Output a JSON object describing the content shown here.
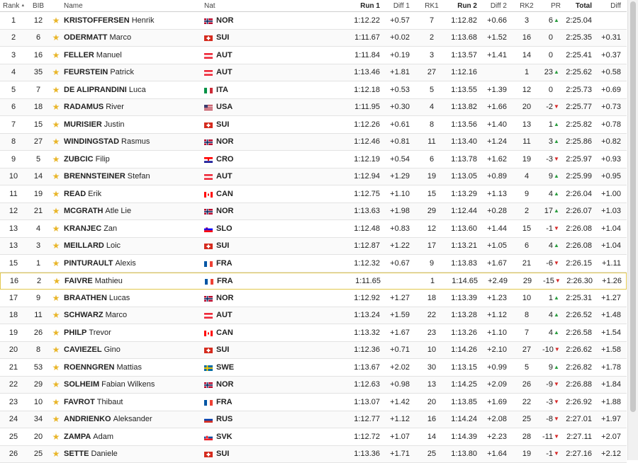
{
  "headers": {
    "rank": "Rank",
    "bib": "BIB",
    "name": "Name",
    "nat": "Nat",
    "run1": "Run 1",
    "diff1": "Diff 1",
    "rk1": "RK1",
    "run2": "Run 2",
    "diff2": "Diff 2",
    "rk2": "RK2",
    "pr": "PR",
    "total": "Total",
    "diff": "Diff"
  },
  "highlight_rank_row": 15,
  "rows": [
    {
      "rank": "1",
      "bib": "12",
      "last": "KRISTOFFERSEN",
      "first": "Henrik",
      "nat": "NOR",
      "flag": "nor",
      "run1": "1:12.22",
      "diff1": "+0.57",
      "rk1": "7",
      "run2": "1:12.82",
      "diff2": "+0.66",
      "rk2": "3",
      "pr": "6",
      "pr_dir": "up",
      "total": "2:25.04",
      "diff": ""
    },
    {
      "rank": "2",
      "bib": "6",
      "last": "ODERMATT",
      "first": "Marco",
      "nat": "SUI",
      "flag": "sui",
      "run1": "1:11.67",
      "diff1": "+0.02",
      "rk1": "2",
      "run2": "1:13.68",
      "diff2": "+1.52",
      "rk2": "16",
      "pr": "0",
      "pr_dir": "zero",
      "total": "2:25.35",
      "diff": "+0.31"
    },
    {
      "rank": "3",
      "bib": "16",
      "last": "FELLER",
      "first": "Manuel",
      "nat": "AUT",
      "flag": "aut",
      "run1": "1:11.84",
      "diff1": "+0.19",
      "rk1": "3",
      "run2": "1:13.57",
      "diff2": "+1.41",
      "rk2": "14",
      "pr": "0",
      "pr_dir": "zero",
      "total": "2:25.41",
      "diff": "+0.37"
    },
    {
      "rank": "4",
      "bib": "35",
      "last": "FEURSTEIN",
      "first": "Patrick",
      "nat": "AUT",
      "flag": "aut",
      "run1": "1:13.46",
      "diff1": "+1.81",
      "rk1": "27",
      "run2": "1:12.16",
      "diff2": "",
      "rk2": "1",
      "pr": "23",
      "pr_dir": "up",
      "total": "2:25.62",
      "diff": "+0.58"
    },
    {
      "rank": "5",
      "bib": "7",
      "last": "DE ALIPRANDINI",
      "first": "Luca",
      "nat": "ITA",
      "flag": "ita",
      "run1": "1:12.18",
      "diff1": "+0.53",
      "rk1": "5",
      "run2": "1:13.55",
      "diff2": "+1.39",
      "rk2": "12",
      "pr": "0",
      "pr_dir": "zero",
      "total": "2:25.73",
      "diff": "+0.69"
    },
    {
      "rank": "6",
      "bib": "18",
      "last": "RADAMUS",
      "first": "River",
      "nat": "USA",
      "flag": "usa",
      "run1": "1:11.95",
      "diff1": "+0.30",
      "rk1": "4",
      "run2": "1:13.82",
      "diff2": "+1.66",
      "rk2": "20",
      "pr": "-2",
      "pr_dir": "down",
      "total": "2:25.77",
      "diff": "+0.73"
    },
    {
      "rank": "7",
      "bib": "15",
      "last": "MURISIER",
      "first": "Justin",
      "nat": "SUI",
      "flag": "sui",
      "run1": "1:12.26",
      "diff1": "+0.61",
      "rk1": "8",
      "run2": "1:13.56",
      "diff2": "+1.40",
      "rk2": "13",
      "pr": "1",
      "pr_dir": "up",
      "total": "2:25.82",
      "diff": "+0.78"
    },
    {
      "rank": "8",
      "bib": "27",
      "last": "WINDINGSTAD",
      "first": "Rasmus",
      "nat": "NOR",
      "flag": "nor",
      "run1": "1:12.46",
      "diff1": "+0.81",
      "rk1": "11",
      "run2": "1:13.40",
      "diff2": "+1.24",
      "rk2": "11",
      "pr": "3",
      "pr_dir": "up",
      "total": "2:25.86",
      "diff": "+0.82"
    },
    {
      "rank": "9",
      "bib": "5",
      "last": "ZUBCIC",
      "first": "Filip",
      "nat": "CRO",
      "flag": "cro",
      "run1": "1:12.19",
      "diff1": "+0.54",
      "rk1": "6",
      "run2": "1:13.78",
      "diff2": "+1.62",
      "rk2": "19",
      "pr": "-3",
      "pr_dir": "down",
      "total": "2:25.97",
      "diff": "+0.93"
    },
    {
      "rank": "10",
      "bib": "14",
      "last": "BRENNSTEINER",
      "first": "Stefan",
      "nat": "AUT",
      "flag": "aut",
      "run1": "1:12.94",
      "diff1": "+1.29",
      "rk1": "19",
      "run2": "1:13.05",
      "diff2": "+0.89",
      "rk2": "4",
      "pr": "9",
      "pr_dir": "up",
      "total": "2:25.99",
      "diff": "+0.95"
    },
    {
      "rank": "11",
      "bib": "19",
      "last": "READ",
      "first": "Erik",
      "nat": "CAN",
      "flag": "can",
      "run1": "1:12.75",
      "diff1": "+1.10",
      "rk1": "15",
      "run2": "1:13.29",
      "diff2": "+1.13",
      "rk2": "9",
      "pr": "4",
      "pr_dir": "up",
      "total": "2:26.04",
      "diff": "+1.00"
    },
    {
      "rank": "12",
      "bib": "21",
      "last": "MCGRATH",
      "first": "Atle Lie",
      "nat": "NOR",
      "flag": "nor",
      "run1": "1:13.63",
      "diff1": "+1.98",
      "rk1": "29",
      "run2": "1:12.44",
      "diff2": "+0.28",
      "rk2": "2",
      "pr": "17",
      "pr_dir": "up",
      "total": "2:26.07",
      "diff": "+1.03"
    },
    {
      "rank": "13",
      "bib": "4",
      "last": "KRANJEC",
      "first": "Zan",
      "nat": "SLO",
      "flag": "slo",
      "run1": "1:12.48",
      "diff1": "+0.83",
      "rk1": "12",
      "run2": "1:13.60",
      "diff2": "+1.44",
      "rk2": "15",
      "pr": "-1",
      "pr_dir": "down",
      "total": "2:26.08",
      "diff": "+1.04"
    },
    {
      "rank": "13",
      "bib": "3",
      "last": "MEILLARD",
      "first": "Loic",
      "nat": "SUI",
      "flag": "sui",
      "run1": "1:12.87",
      "diff1": "+1.22",
      "rk1": "17",
      "run2": "1:13.21",
      "diff2": "+1.05",
      "rk2": "6",
      "pr": "4",
      "pr_dir": "up",
      "total": "2:26.08",
      "diff": "+1.04"
    },
    {
      "rank": "15",
      "bib": "1",
      "last": "PINTURAULT",
      "first": "Alexis",
      "nat": "FRA",
      "flag": "fra",
      "run1": "1:12.32",
      "diff1": "+0.67",
      "rk1": "9",
      "run2": "1:13.83",
      "diff2": "+1.67",
      "rk2": "21",
      "pr": "-6",
      "pr_dir": "down",
      "total": "2:26.15",
      "diff": "+1.11"
    },
    {
      "rank": "16",
      "bib": "2",
      "last": "FAIVRE",
      "first": "Mathieu",
      "nat": "FRA",
      "flag": "fra",
      "run1": "1:11.65",
      "diff1": "",
      "rk1": "1",
      "run2": "1:14.65",
      "diff2": "+2.49",
      "rk2": "29",
      "pr": "-15",
      "pr_dir": "down",
      "total": "2:26.30",
      "diff": "+1.26"
    },
    {
      "rank": "17",
      "bib": "9",
      "last": "BRAATHEN",
      "first": "Lucas",
      "nat": "NOR",
      "flag": "nor",
      "run1": "1:12.92",
      "diff1": "+1.27",
      "rk1": "18",
      "run2": "1:13.39",
      "diff2": "+1.23",
      "rk2": "10",
      "pr": "1",
      "pr_dir": "up",
      "total": "2:25.31",
      "diff": "+1.27"
    },
    {
      "rank": "18",
      "bib": "11",
      "last": "SCHWARZ",
      "first": "Marco",
      "nat": "AUT",
      "flag": "aut",
      "run1": "1:13.24",
      "diff1": "+1.59",
      "rk1": "22",
      "run2": "1:13.28",
      "diff2": "+1.12",
      "rk2": "8",
      "pr": "4",
      "pr_dir": "up",
      "total": "2:26.52",
      "diff": "+1.48"
    },
    {
      "rank": "19",
      "bib": "26",
      "last": "PHILP",
      "first": "Trevor",
      "nat": "CAN",
      "flag": "can",
      "run1": "1:13.32",
      "diff1": "+1.67",
      "rk1": "23",
      "run2": "1:13.26",
      "diff2": "+1.10",
      "rk2": "7",
      "pr": "4",
      "pr_dir": "up",
      "total": "2:26.58",
      "diff": "+1.54"
    },
    {
      "rank": "20",
      "bib": "8",
      "last": "CAVIEZEL",
      "first": "Gino",
      "nat": "SUI",
      "flag": "sui",
      "run1": "1:12.36",
      "diff1": "+0.71",
      "rk1": "10",
      "run2": "1:14.26",
      "diff2": "+2.10",
      "rk2": "27",
      "pr": "-10",
      "pr_dir": "down",
      "total": "2:26.62",
      "diff": "+1.58"
    },
    {
      "rank": "21",
      "bib": "53",
      "last": "ROENNGREN",
      "first": "Mattias",
      "nat": "SWE",
      "flag": "swe",
      "run1": "1:13.67",
      "diff1": "+2.02",
      "rk1": "30",
      "run2": "1:13.15",
      "diff2": "+0.99",
      "rk2": "5",
      "pr": "9",
      "pr_dir": "up",
      "total": "2:26.82",
      "diff": "+1.78"
    },
    {
      "rank": "22",
      "bib": "29",
      "last": "SOLHEIM",
      "first": "Fabian Wilkens",
      "nat": "NOR",
      "flag": "nor",
      "run1": "1:12.63",
      "diff1": "+0.98",
      "rk1": "13",
      "run2": "1:14.25",
      "diff2": "+2.09",
      "rk2": "26",
      "pr": "-9",
      "pr_dir": "down",
      "total": "2:26.88",
      "diff": "+1.84"
    },
    {
      "rank": "23",
      "bib": "10",
      "last": "FAVROT",
      "first": "Thibaut",
      "nat": "FRA",
      "flag": "fra",
      "run1": "1:13.07",
      "diff1": "+1.42",
      "rk1": "20",
      "run2": "1:13.85",
      "diff2": "+1.69",
      "rk2": "22",
      "pr": "-3",
      "pr_dir": "down",
      "total": "2:26.92",
      "diff": "+1.88"
    },
    {
      "rank": "24",
      "bib": "34",
      "last": "ANDRIENKO",
      "first": "Aleksander",
      "nat": "RUS",
      "flag": "rus",
      "run1": "1:12.77",
      "diff1": "+1.12",
      "rk1": "16",
      "run2": "1:14.24",
      "diff2": "+2.08",
      "rk2": "25",
      "pr": "-8",
      "pr_dir": "down",
      "total": "2:27.01",
      "diff": "+1.97"
    },
    {
      "rank": "25",
      "bib": "20",
      "last": "ZAMPA",
      "first": "Adam",
      "nat": "SVK",
      "flag": "svk",
      "run1": "1:12.72",
      "diff1": "+1.07",
      "rk1": "14",
      "run2": "1:14.39",
      "diff2": "+2.23",
      "rk2": "28",
      "pr": "-11",
      "pr_dir": "down",
      "total": "2:27.11",
      "diff": "+2.07"
    },
    {
      "rank": "26",
      "bib": "25",
      "last": "SETTE",
      "first": "Daniele",
      "nat": "SUI",
      "flag": "sui",
      "run1": "1:13.36",
      "diff1": "+1.71",
      "rk1": "25",
      "run2": "1:13.80",
      "diff2": "+1.64",
      "rk2": "19",
      "pr": "-1",
      "pr_dir": "down",
      "total": "2:27.16",
      "diff": "+2.12"
    }
  ],
  "colors": {
    "star": "#e9b62a",
    "pr_up": "#2a9d3f",
    "pr_down": "#d62828",
    "highlight_border": "#e2c84e"
  },
  "icons": {
    "star": "star-icon",
    "pr_up": "triangle-up-icon",
    "pr_down": "triangle-down-icon",
    "sort": "sort-arrow-icon"
  }
}
